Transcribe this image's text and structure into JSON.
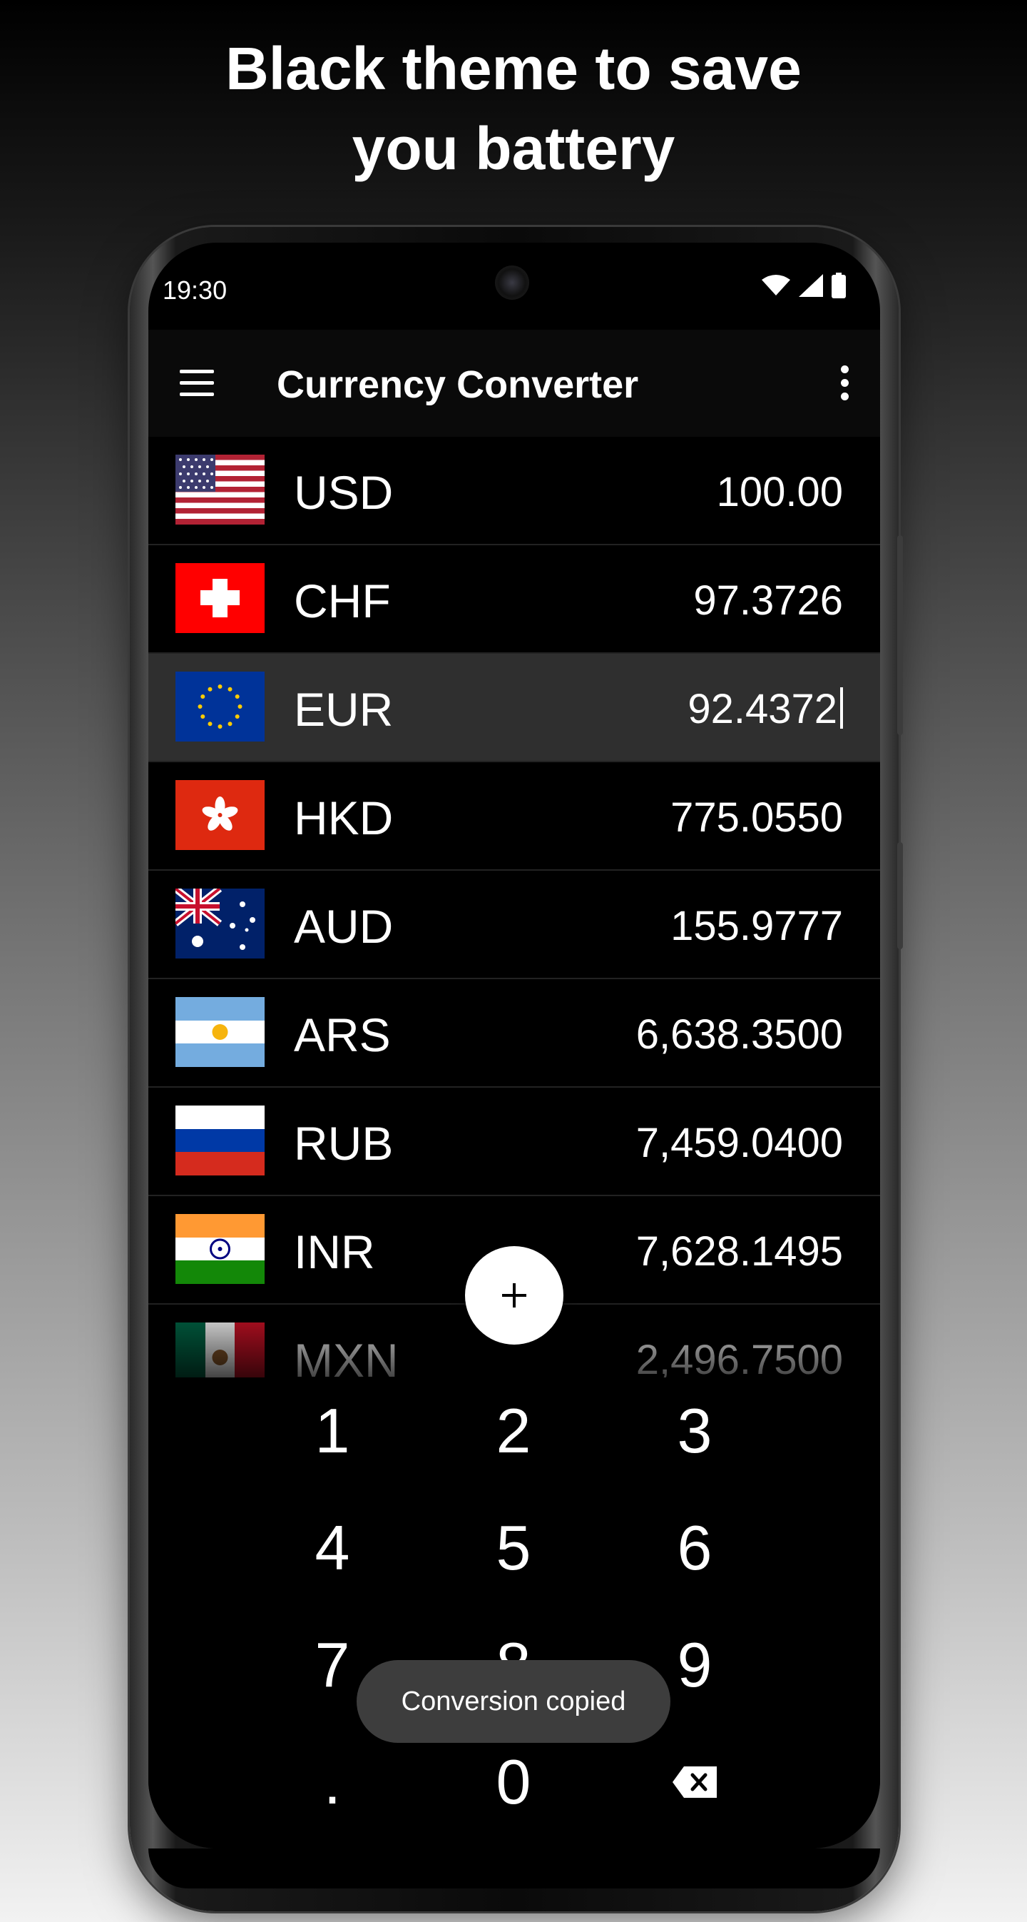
{
  "promo": {
    "line1": "Black theme to save",
    "line2": "you battery"
  },
  "status_bar": {
    "time": "19:30",
    "icons": [
      "wifi-icon",
      "cell-signal-icon",
      "battery-icon"
    ]
  },
  "app_bar": {
    "title": "Currency Converter",
    "menu_icon": "hamburger-menu-icon",
    "overflow_icon": "more-vertical-icon"
  },
  "currencies": [
    {
      "code": "USD",
      "value": "100.00",
      "flag": "us-flag-icon"
    },
    {
      "code": "CHF",
      "value": "97.3726",
      "flag": "ch-flag-icon"
    },
    {
      "code": "EUR",
      "value": "92.4372",
      "flag": "eu-flag-icon",
      "selected": true
    },
    {
      "code": "HKD",
      "value": "775.0550",
      "flag": "hk-flag-icon"
    },
    {
      "code": "AUD",
      "value": "155.9777",
      "flag": "au-flag-icon"
    },
    {
      "code": "ARS",
      "value": "6,638.3500",
      "flag": "ar-flag-icon"
    },
    {
      "code": "RUB",
      "value": "7,459.0400",
      "flag": "ru-flag-icon"
    },
    {
      "code": "INR",
      "value": "7,628.1495",
      "flag": "in-flag-icon"
    },
    {
      "code": "MXN",
      "value": "2,496.7500",
      "flag": "mx-flag-icon"
    }
  ],
  "fab": {
    "icon": "plus-icon"
  },
  "keypad": {
    "keys": [
      "1",
      "2",
      "3",
      "4",
      "5",
      "6",
      "7",
      "8",
      "9",
      ".",
      "0"
    ],
    "backspace_icon": "backspace-icon"
  },
  "toast": {
    "text": "Conversion copied"
  },
  "colors": {
    "background_top": "#000000",
    "background_bottom": "#f2f2f2",
    "screen": "#000000",
    "selected_row": "#2f2f2f",
    "fab": "#ffffff"
  }
}
